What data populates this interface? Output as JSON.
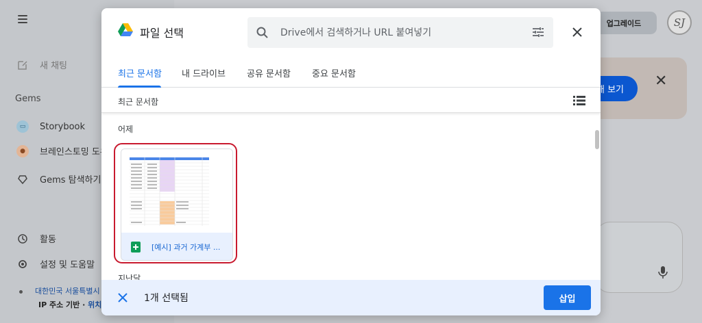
{
  "background": {
    "sidebar": {
      "new_chat": "새 채팅",
      "gems_heading": "Gems",
      "items": [
        {
          "label": "Storybook",
          "icon": "book-icon"
        },
        {
          "label": "브레인스토밍 도우",
          "icon": "lightbulb-icon"
        },
        {
          "label": "Gems 탐색하기",
          "icon": "gem-explore-icon"
        }
      ],
      "activity": "활동",
      "settings": "설정 및 도움말",
      "location": "대한민국 서울특별시",
      "ip_basis": "IP 주소 기반 · ",
      "ip_link": "위치"
    },
    "header": {
      "upgrade": "업그레이드",
      "avatar_initials": "SJ"
    },
    "banner": {
      "button": "해 보기"
    }
  },
  "dialog": {
    "title": "파일 선택",
    "search": {
      "placeholder": "Drive에서 검색하거나 URL 붙여넣기"
    },
    "tabs": [
      {
        "label": "최근 문서함",
        "active": true
      },
      {
        "label": "내 드라이브",
        "active": false
      },
      {
        "label": "공유 문서함",
        "active": false
      },
      {
        "label": "중요 문서함",
        "active": false
      }
    ],
    "subheader": "최근 문서함",
    "sections": [
      {
        "label": "어제"
      },
      {
        "label": "지난달"
      }
    ],
    "file": {
      "name": "[예시] 과거 가계부 ...",
      "type": "sheets"
    },
    "footer": {
      "selected_count": "1개 선택됨",
      "insert": "삽입"
    }
  },
  "colors": {
    "accent": "#1a73e8",
    "selection_border": "#c8192e",
    "sheets_green": "#0f9d58"
  }
}
